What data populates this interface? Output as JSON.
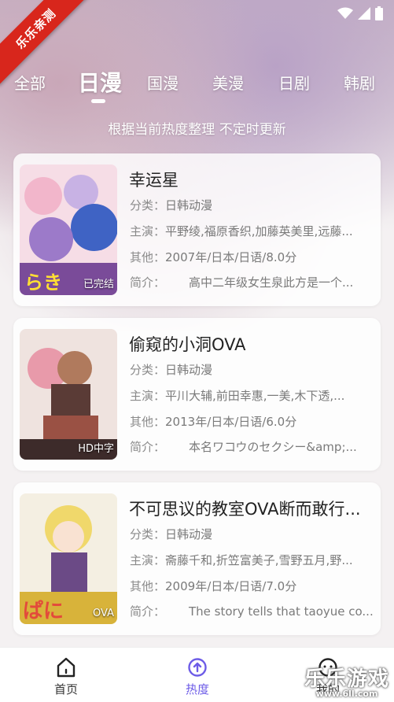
{
  "ribbon_label": "乐乐亲测",
  "tabs": [
    {
      "label": "全部"
    },
    {
      "label": "日漫"
    },
    {
      "label": "国漫"
    },
    {
      "label": "美漫"
    },
    {
      "label": "日剧"
    },
    {
      "label": "韩剧"
    }
  ],
  "active_tab": "日漫",
  "subtitle": "根据当前热度整理 不定时更新",
  "items": [
    {
      "title": "幸运星",
      "category_label": "分类：",
      "category": "日韩动漫",
      "cast_label": "主演：",
      "cast": "平野绫,福原香织,加藤英美里,远藤...",
      "other_label": "其他：",
      "other": "2007年/日本/日语/8.0分",
      "intro_label": "简介：",
      "intro": "高中二年级女生泉此方是一个...",
      "badge": "已完结"
    },
    {
      "title": "偷窥的小洞OVA",
      "category_label": "分类：",
      "category": "日韩动漫",
      "cast_label": "主演：",
      "cast": "平川大辅,前田幸惠,一美,木下透,...",
      "other_label": "其他：",
      "other": "2013年/日本/日语/6.0分",
      "intro_label": "简介：",
      "intro": "本名ワコウのセクシー&amp;...",
      "badge": "HD中字"
    },
    {
      "title": "不可思议的教室OVA断而敢行...",
      "category_label": "分类：",
      "category": "日韩动漫",
      "cast_label": "主演：",
      "cast": "斋藤千和,折笠富美子,雪野五月,野...",
      "other_label": "其他：",
      "other": "2009年/日本/日语/7.0分",
      "intro_label": "简介：",
      "intro": "The story tells that taoyue co...",
      "badge": "OVA"
    }
  ],
  "nav": {
    "home": "首页",
    "hot": "热度",
    "me": "我的"
  },
  "watermark": {
    "line1": "乐乐游戏",
    "line2": "www.6ll.com"
  },
  "colors": {
    "accent": "#6d5ce7",
    "ribbon": "#d8261c"
  },
  "icons": [
    "wifi-icon",
    "signal-icon",
    "battery-icon",
    "home-icon",
    "hot-up-arrow-icon",
    "profile-icon"
  ]
}
